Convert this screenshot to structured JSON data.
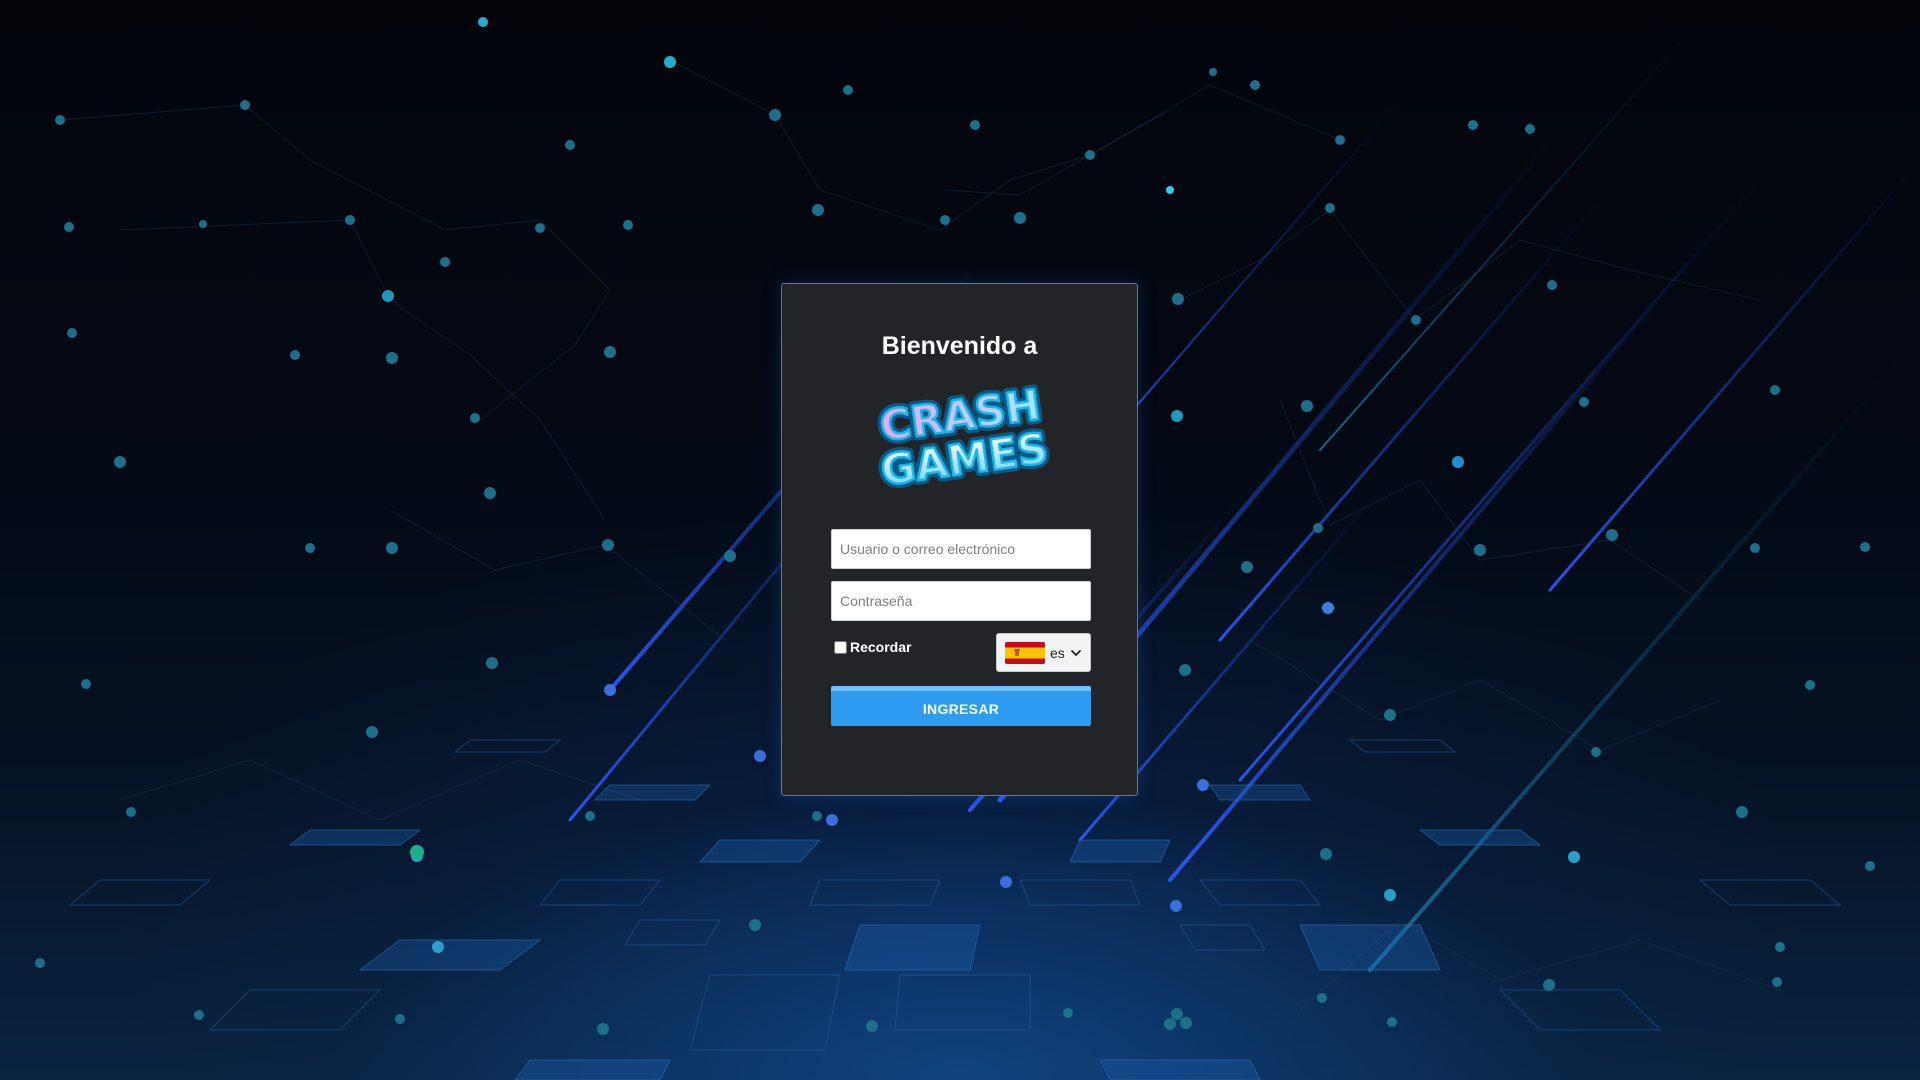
{
  "login": {
    "title": "Bienvenido a",
    "logo": {
      "line1": "CRASH",
      "line2": "GAMES"
    },
    "username_placeholder": "Usuario o correo electrónico",
    "password_placeholder": "Contraseña",
    "remember_label": "Recordar",
    "language": {
      "code": "es",
      "flag": "spain-flag-icon"
    },
    "submit_label": "INGRESAR"
  },
  "colors": {
    "card_bg": "#232427",
    "card_border": "#3f7fd0",
    "button_bg": "#2f9cf4",
    "background": "#03060c"
  }
}
